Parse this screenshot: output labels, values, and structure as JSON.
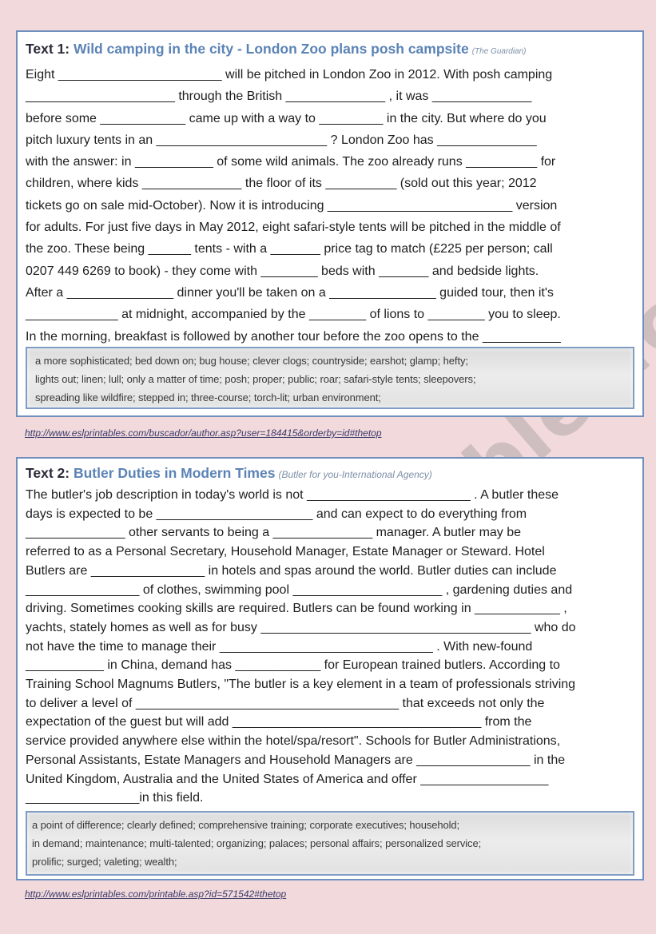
{
  "page": {
    "background_color": "#f2dadc",
    "border_color": "#6f8fbc",
    "accent_color": "#5b83b5"
  },
  "text1": {
    "label": "Text 1: ",
    "headline": "Wild camping in the city - London Zoo plans posh campsite",
    "source": "(The Guardian)",
    "lines": [
      "Eight _______________________ will be pitched in London Zoo in 2012. With posh camping",
      "_____________________ through the British ______________ , it was ______________",
      "before some ____________ came up with a way to _________ in the city. But where do you",
      "pitch luxury tents in an ________________________ ? London Zoo has ______________",
      "with the answer: in ___________ of some wild animals. The zoo already runs __________ for",
      "children, where kids ______________ the floor of its __________ (sold out this year; 2012",
      "tickets go on sale mid-October). Now it is introducing __________________________ version",
      "for adults. For just five days in May 2012, eight safari-style tents will be pitched in the middle of",
      "the zoo. These being ______ tents - with a _______ price tag to match (£225 per person; call",
      "0207 449 6269 to book) - they come with ________ beds with _______ and bedside lights.",
      "After a _______________  dinner you'll be taken on a _______________ guided tour, then it's",
      "_____________ at midnight, accompanied by the ________ of lions to ________ you to sleep.",
      "In the morning, breakfast is followed by another tour before the zoo opens to the ___________"
    ],
    "word_bank": [
      "a more sophisticated; bed down on;  bug house;  clever clogs;  countryside;   earshot;  glamp;  hefty;",
      "lights out;  linen;  lull;  only a matter of time;  posh;  proper;  public;  roar;  safari-style tents;  sleepovers;",
      "spreading like wildfire;  stepped in;     three-course;  torch-lit;  urban environment;"
    ],
    "link": "http://www.eslprintables.com/buscador/author.asp?user=184415&orderby=id#thetop"
  },
  "text2": {
    "label": "Text 2: ",
    "headline": "Butler Duties in Modern Times",
    "source": "(Butler for you-International Agency)",
    "lines": [
      "The butler's job description in today's world is not _______________________ . A butler these",
      "days is expected to be ______________________ and can expect to do everything from",
      "______________ other servants to being a ______________ manager. A butler may be",
      "referred to as a Personal Secretary, Household Manager, Estate Manager or Steward. Hotel",
      "Butlers are ________________ in hotels and spas around the world. Butler duties can include",
      "________________ of clothes, swimming pool _____________________ , gardening duties and",
      "driving. Sometimes cooking skills are required. Butlers can be found working in ____________ ,",
      "yachts, stately homes as well as for busy ______________________________________ who do",
      "not have the time to manage their ______________________________ . With new-found",
      "___________ in China, demand has ____________ for European trained butlers. According to",
      "Training School Magnums Butlers, \"The butler is a key element in a team of professionals striving",
      "to deliver a level of _____________________________________ that exceeds not only the",
      "expectation of the guest but will add ___________________________________ from the",
      "service provided anywhere else within the hotel/spa/resort\". Schools for Butler Administrations,",
      "Personal Assistants, Estate Managers and Household Managers are ________________ in the",
      "United Kingdom, Australia and the United States of America and offer __________________",
      "________________in this field."
    ],
    "word_bank": [
      "a point of difference;  clearly defined;  comprehensive training;  corporate executives;  household;",
      "in demand;  maintenance;  multi-talented;  organizing;  palaces;  personal affairs;  personalized service;",
      "prolific;  surged;  valeting;  wealth;"
    ],
    "link": "http://www.eslprintables.com/printable.asp?id=571542#thetop"
  },
  "watermark": "ESLprintables.com"
}
